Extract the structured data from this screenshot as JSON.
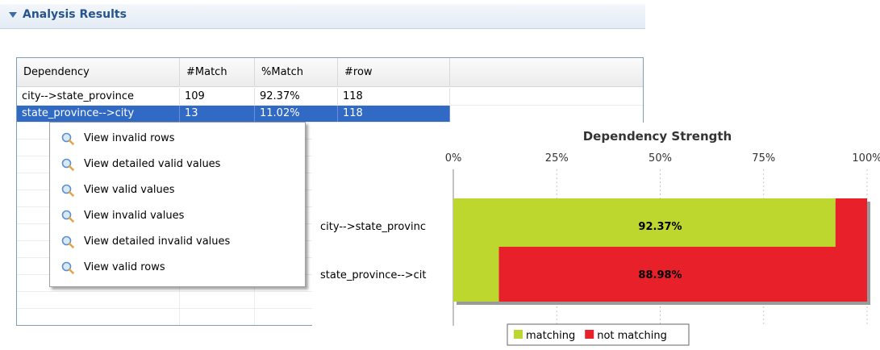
{
  "section": {
    "title": "Analysis Results"
  },
  "table": {
    "headers": [
      "Dependency",
      "#Match",
      "%Match",
      "#row"
    ],
    "rows": [
      {
        "dependency": "city-->state_province",
        "match": "109",
        "pct": "92.37%",
        "rows": "118",
        "selected": false
      },
      {
        "dependency": "state_province-->city",
        "match": "13",
        "pct": "11.02%",
        "rows": "118",
        "selected": true
      }
    ]
  },
  "context_menu": {
    "items": [
      {
        "label": "View invalid rows",
        "icon": "magnifier-icon"
      },
      {
        "label": "View detailed valid values",
        "icon": "magnifier-icon"
      },
      {
        "label": "View valid values",
        "icon": "magnifier-icon"
      },
      {
        "label": "View invalid values",
        "icon": "magnifier-icon"
      },
      {
        "label": "View detailed invalid values",
        "icon": "magnifier-icon"
      },
      {
        "label": "View valid rows",
        "icon": "magnifier-icon"
      }
    ]
  },
  "chart_data": {
    "type": "bar",
    "orientation": "horizontal",
    "stacked": true,
    "percent_stacked": true,
    "title": "Dependency Strength",
    "categories": [
      "city-->state_provinc",
      "state_province-->cit"
    ],
    "series": [
      {
        "name": "matching",
        "values": [
          92.37,
          11.02
        ],
        "color": "#bdd72f"
      },
      {
        "name": "not matching",
        "values": [
          7.63,
          88.98
        ],
        "color": "#e8202a"
      }
    ],
    "x_ticks": [
      "0%",
      "25%",
      "50%",
      "75%",
      "100%"
    ],
    "xlim": [
      0,
      100
    ],
    "data_labels": [
      "92.37%",
      "88.98%"
    ],
    "grid": true,
    "legend_position": "bottom"
  }
}
